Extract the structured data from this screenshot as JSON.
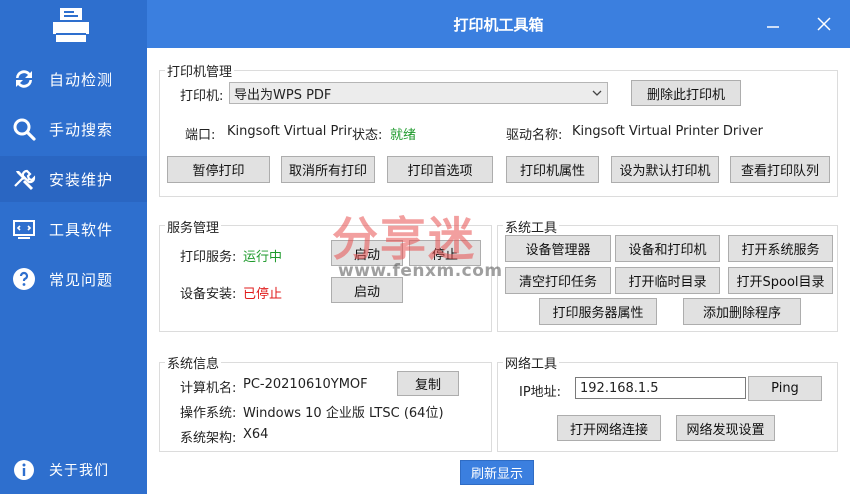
{
  "app": {
    "title": "打印机工具箱"
  },
  "sidebar": {
    "items": [
      {
        "label": "自动检测",
        "icon": "refresh-icon"
      },
      {
        "label": "手动搜索",
        "icon": "search-icon"
      },
      {
        "label": "安装维护",
        "icon": "tools-icon"
      },
      {
        "label": "工具软件",
        "icon": "monitor-icon"
      },
      {
        "label": "常见问题",
        "icon": "question-icon"
      }
    ],
    "about_label": "关于我们"
  },
  "printer_mgmt": {
    "title": "打印机管理",
    "printer_label": "打印机:",
    "printer_selected": "导出为WPS PDF",
    "delete_btn": "删除此打印机",
    "port_label": "端口:",
    "port_value": "Kingsoft Virtual Print",
    "status_label": "状态:",
    "status_value": "就绪",
    "driver_label": "驱动名称:",
    "driver_value": "Kingsoft Virtual Printer Driver",
    "buttons": [
      "暂停打印",
      "取消所有打印",
      "打印首选项",
      "打印机属性",
      "设为默认打印机",
      "查看打印队列"
    ]
  },
  "service_mgmt": {
    "title": "服务管理",
    "print_service_label": "打印服务:",
    "print_service_status": "运行中",
    "start_btn_1": "启动",
    "stop_btn": "停止",
    "device_install_label": "设备安装:",
    "device_install_status": "已停止",
    "start_btn_2": "启动"
  },
  "system_tools": {
    "title": "系统工具",
    "buttons": [
      "设备管理器",
      "设备和打印机",
      "打开系统服务",
      "清空打印任务",
      "打开临时目录",
      "打开Spool目录",
      "打印服务器属性",
      "添加删除程序"
    ]
  },
  "system_info": {
    "title": "系统信息",
    "computer_label": "计算机名:",
    "computer_value": "PC-20210610YMOF",
    "copy_btn": "复制",
    "os_label": "操作系统:",
    "os_value": "Windows 10 企业版 LTSC (64位)",
    "arch_label": "系统架构:",
    "arch_value": "X64"
  },
  "network_tools": {
    "title": "网络工具",
    "ip_label": "IP地址:",
    "ip_value": "192.168.1.5",
    "ping_btn": "Ping",
    "open_conn_btn": "打开网络连接",
    "discovery_btn": "网络发现设置"
  },
  "refresh_btn": "刷新显示",
  "watermark": {
    "brand": "分享迷",
    "url": "www.fenxm.com"
  },
  "colors": {
    "sidebar_bg": "#2e6fce",
    "titlebar_bg": "#3b7fdf",
    "status_green": "#1e9a2c",
    "status_red": "#e01b1b"
  }
}
